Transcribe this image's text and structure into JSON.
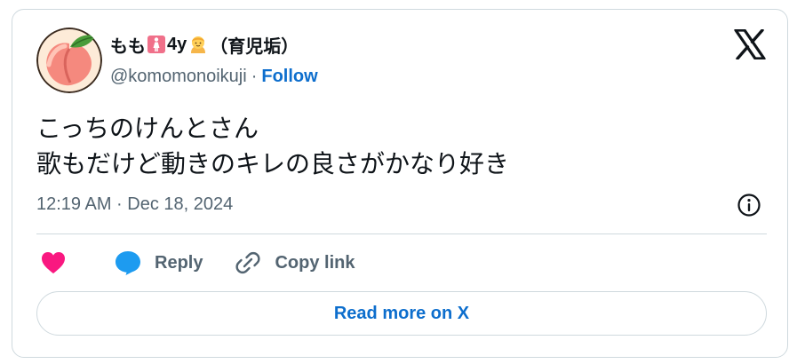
{
  "author": {
    "name_prefix": "もも",
    "name_age": "4y",
    "name_suffix": "（育児垢）",
    "handle": "@komomonoikuji",
    "separator": "·",
    "follow_label": "Follow",
    "avatar_icon": "peach-icon",
    "name_icons": [
      "girl-sign-icon",
      "child-emoji-icon"
    ]
  },
  "tweet": {
    "lines": [
      "こっちのけんとさん",
      "歌もだけど動きのキレの良さがかなり好き"
    ],
    "timestamp": "12:19 AM · Dec 18, 2024"
  },
  "actions": {
    "like_icon": "heart-icon",
    "reply_label": "Reply",
    "copy_link_label": "Copy link"
  },
  "read_more_label": "Read more on X",
  "colors": {
    "text": "#0f1419",
    "secondary": "#536471",
    "link": "#0d6ecd",
    "like": "#f91880",
    "reply": "#1d9bf0",
    "border": "#cfd9de"
  }
}
